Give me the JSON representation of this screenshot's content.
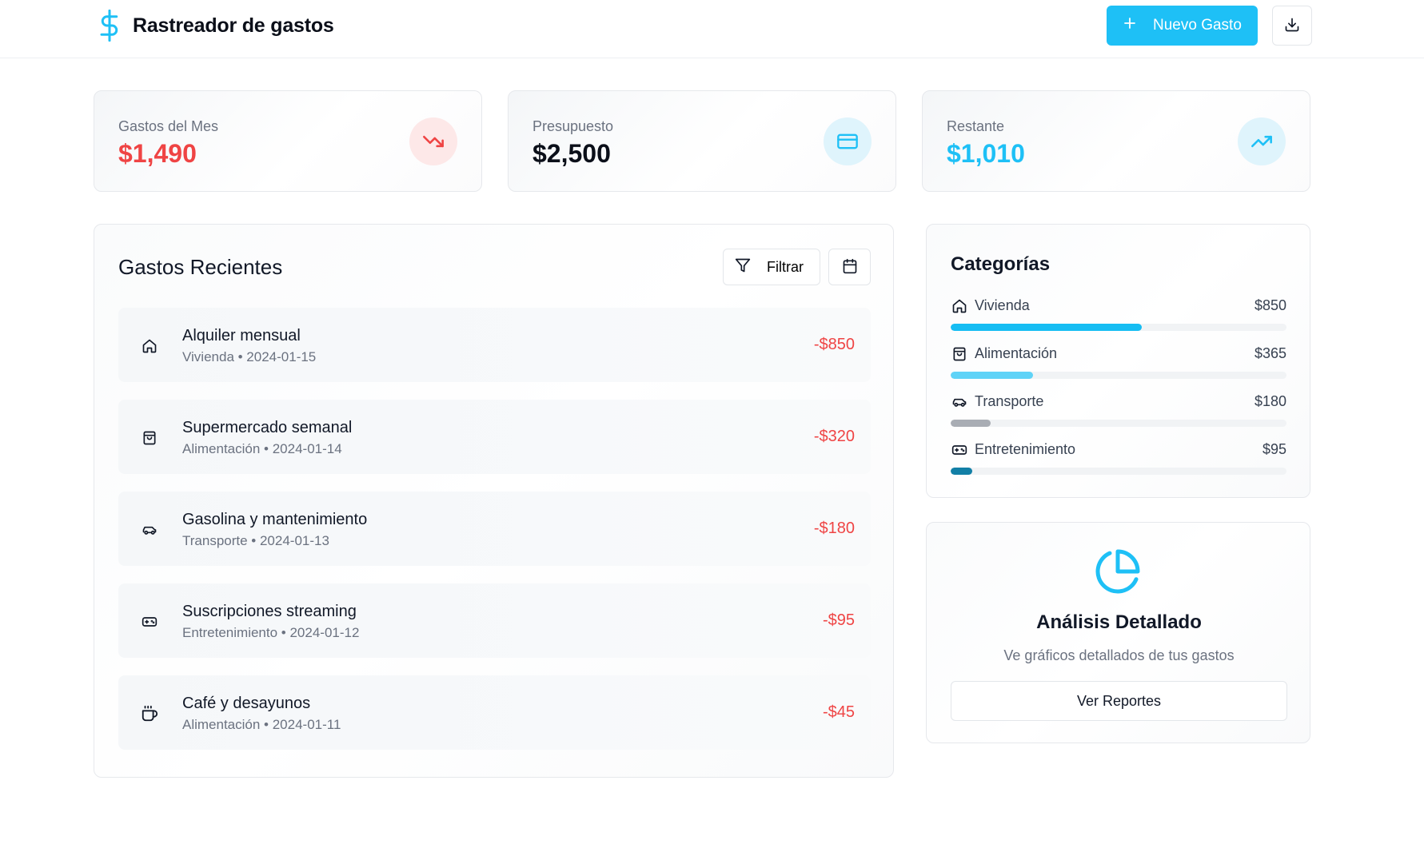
{
  "header": {
    "title": "Rastreador de gastos",
    "new_expense_label": "Nuevo Gasto",
    "brand_icon": "dollar-sign-icon",
    "download_icon": "download-icon"
  },
  "stats": [
    {
      "label": "Gastos del Mes",
      "value": "$1,490",
      "value_color": "#ef4444",
      "icon": "trending-down-icon"
    },
    {
      "label": "Presupuesto",
      "value": "$2,500",
      "value_color": "#0b0f19",
      "icon": "credit-card-icon"
    },
    {
      "label": "Restante",
      "value": "$1,010",
      "value_color": "#1ec0f6",
      "icon": "trending-up-icon"
    }
  ],
  "recent": {
    "title": "Gastos Recientes",
    "filter_label": "Filtrar",
    "items": [
      {
        "name": "Alquiler mensual",
        "meta": "Vivienda • 2024-01-15",
        "amount": "-$850",
        "icon": "home-icon"
      },
      {
        "name": "Supermercado semanal",
        "meta": "Alimentación • 2024-01-14",
        "amount": "-$320",
        "icon": "shopping-bag-icon"
      },
      {
        "name": "Gasolina y mantenimiento",
        "meta": "Transporte • 2024-01-13",
        "amount": "-$180",
        "icon": "car-icon"
      },
      {
        "name": "Suscripciones streaming",
        "meta": "Entretenimiento • 2024-01-12",
        "amount": "-$95",
        "icon": "gamepad-icon"
      },
      {
        "name": "Café y desayunos",
        "meta": "Alimentación • 2024-01-11",
        "amount": "-$45",
        "icon": "coffee-icon"
      }
    ]
  },
  "categories": {
    "title": "Categorías",
    "items": [
      {
        "label": "Vivienda",
        "value": "$850",
        "share": 0.57,
        "color": "#16bdf3",
        "icon": "home-icon"
      },
      {
        "label": "Alimentación",
        "value": "$365",
        "share": 0.245,
        "color": "#5fd3f7",
        "icon": "shopping-bag-icon"
      },
      {
        "label": "Transporte",
        "value": "$180",
        "share": 0.12,
        "color": "#a9adb4",
        "icon": "car-icon"
      },
      {
        "label": "Entretenimiento",
        "value": "$95",
        "share": 0.064,
        "color": "#127fa6",
        "icon": "gamepad-icon"
      }
    ]
  },
  "analysis": {
    "title": "Análisis Detallado",
    "subtitle": "Ve gráficos detallados de tus gastos",
    "button_label": "Ver Reportes",
    "icon": "pie-chart-icon"
  }
}
